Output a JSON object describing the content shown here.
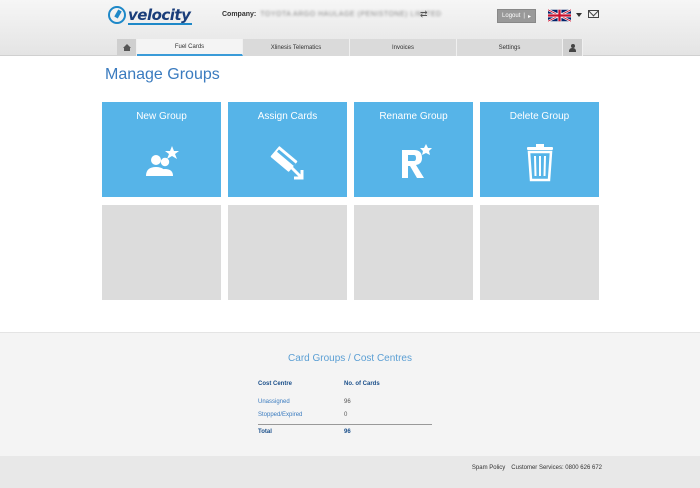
{
  "header": {
    "logo_text": "velocity",
    "company_label": "Company:",
    "company_name": "TOYOTA ARGO HAULAGE (PENISTONE) LIMITED",
    "swap_glyph": "⇄",
    "logout_label": "Logout",
    "logout_separator": "|",
    "logout_arrow": "▸"
  },
  "nav": {
    "tabs": [
      {
        "label": "Fuel Cards"
      },
      {
        "label": "Xlinesis Telematics"
      },
      {
        "label": "Invoices"
      },
      {
        "label": "Settings"
      }
    ]
  },
  "page": {
    "title": "Manage Groups"
  },
  "tiles": [
    {
      "label": "New Group",
      "icon": "users-star-icon"
    },
    {
      "label": "Assign Cards",
      "icon": "card-arrow-icon"
    },
    {
      "label": "Rename Group",
      "icon": "r-star-icon"
    },
    {
      "label": "Delete Group",
      "icon": "trash-icon"
    }
  ],
  "summary": {
    "title": "Card Groups / Cost Centres",
    "col_cost_centre": "Cost Centre",
    "col_num_cards": "No. of Cards",
    "rows": [
      {
        "name": "Unassigned",
        "count": "96"
      },
      {
        "name": "Stopped/Expired",
        "count": "0"
      }
    ],
    "total_label": "Total",
    "total_count": "96"
  },
  "footer": {
    "spam_policy": "Spam Policy",
    "customer_services": "Customer Services: 0800 626 672"
  },
  "colors": {
    "tile_blue": "#56b4e8",
    "tile_empty": "#dcdcdc",
    "title_blue": "#3a7bbf",
    "nav_active_underline": "#3a9bd8"
  }
}
